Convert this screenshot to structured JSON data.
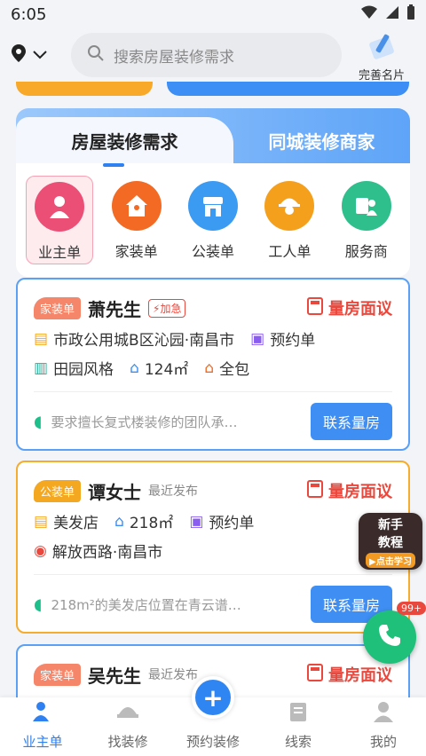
{
  "status": {
    "time": "6:05"
  },
  "header": {
    "search_placeholder": "搜索房屋装修需求",
    "profile_label": "完善名片"
  },
  "tabs": [
    {
      "label": "房屋装修需求"
    },
    {
      "label": "同城装修商家"
    }
  ],
  "categories": [
    {
      "label": "业主单"
    },
    {
      "label": "家装单"
    },
    {
      "label": "公装单"
    },
    {
      "label": "工人单"
    },
    {
      "label": "服务商"
    }
  ],
  "listings": [
    {
      "tag": "家装单",
      "name": "萧先生",
      "flag": "加急",
      "action": "量房面议",
      "address": "市政公用城B区沁园·南昌市",
      "order_type": "预约单",
      "style": "田园风格",
      "area": "124㎡",
      "scope": "全包",
      "desc": "要求擅长复式楼装修的团队承…",
      "button": "联系量房"
    },
    {
      "tag": "公装单",
      "name": "谭女士",
      "time": "最近发布",
      "action": "量房面议",
      "venue": "美发店",
      "area": "218㎡",
      "order_type": "预约单",
      "address": "解放西路·南昌市",
      "desc": "218m²的美发店位置在青云谱…",
      "button": "联系量房"
    },
    {
      "tag": "家装单",
      "name": "吴先生",
      "time": "最近发布",
      "action": "量房面议"
    }
  ],
  "floating": {
    "tutorial_line1": "新手",
    "tutorial_line2": "教程",
    "tutorial_sub": "▶点击学习",
    "call_badge": "99+"
  },
  "nav": [
    {
      "label": "业主单"
    },
    {
      "label": "找装修"
    },
    {
      "label": "预约装修"
    },
    {
      "label": "线索"
    },
    {
      "label": "我的"
    }
  ],
  "colors": {
    "primary": "#2f80f0",
    "danger": "#e8483d",
    "orange": "#f6ac2c"
  }
}
